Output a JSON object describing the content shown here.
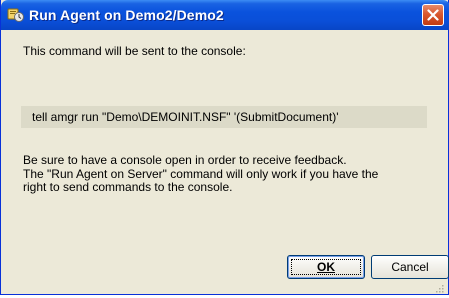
{
  "dialog": {
    "title": "Run Agent on Demo2/Demo2",
    "message": "This command will be sent to the console:",
    "command": "tell amgr run \"Demo\\DEMOINIT.NSF\" '(SubmitDocument)'",
    "info_lines": [
      "Be sure to have a console open in order to receive feedback.",
      "The \"Run Agent on Server\" command will only work if you have the",
      "right to send commands to the console."
    ],
    "ok_label": "OK",
    "cancel_label": "Cancel"
  },
  "icons": {
    "app": "lotus-notes-icon",
    "close": "close-icon",
    "grip": "resize-grip-icon"
  },
  "colors": {
    "titlebar": "#0a52dd",
    "close": "#d9582f",
    "dialog_bg": "#ece9d8",
    "command_bg": "#dcdac8"
  }
}
